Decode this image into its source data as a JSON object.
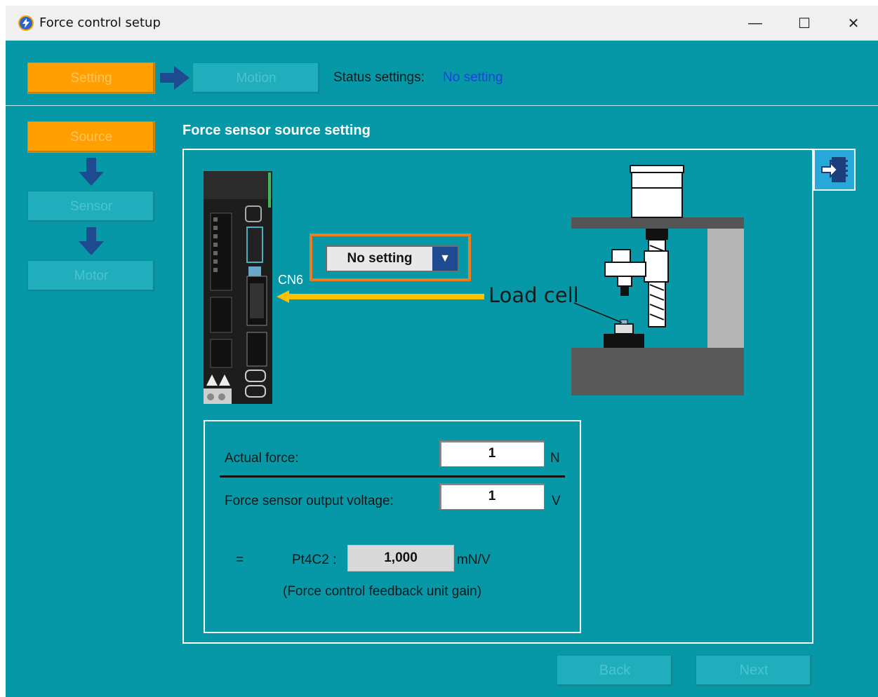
{
  "window": {
    "title": "Force control setup"
  },
  "controls": {
    "minimize": "—",
    "maximize": "☐",
    "close": "✕"
  },
  "wizard": {
    "steps": [
      {
        "label": "Setting",
        "state": "active"
      },
      {
        "label": "Motion",
        "state": "inactive"
      }
    ],
    "status_label": "Status settings:",
    "status_value": "No setting"
  },
  "sidebar": {
    "items": [
      {
        "label": "Source",
        "state": "active"
      },
      {
        "label": "Sensor",
        "state": "inactive"
      },
      {
        "label": "Motor",
        "state": "inactive"
      }
    ]
  },
  "main": {
    "title": "Force sensor source setting",
    "source_dropdown": {
      "selected": "No setting"
    },
    "connector_label": "CN6",
    "load_cell_label": "Load cell",
    "calc": {
      "actual_force_label": "Actual force:",
      "actual_force_value": "1",
      "actual_force_unit": "N",
      "voltage_label": "Force sensor output voltage:",
      "voltage_value": "1",
      "voltage_unit": "V",
      "equals": "=",
      "param_label": "Pt4C2 :",
      "param_value": "1,000",
      "param_unit": "mN/V",
      "param_description": "(Force control feedback unit gain)"
    }
  },
  "nav": {
    "back": "Back",
    "next": "Next"
  },
  "colors": {
    "background": "#0798a8",
    "active": "#ffa000",
    "highlight": "#ee7d22",
    "arrow": "#ffc000",
    "status": "#1546d8"
  },
  "icons": [
    "app-icon",
    "minimize-icon",
    "maximize-icon",
    "close-icon",
    "right-arrow-icon",
    "down-arrow-icon",
    "export-icon",
    "dropdown-arrow-icon"
  ]
}
